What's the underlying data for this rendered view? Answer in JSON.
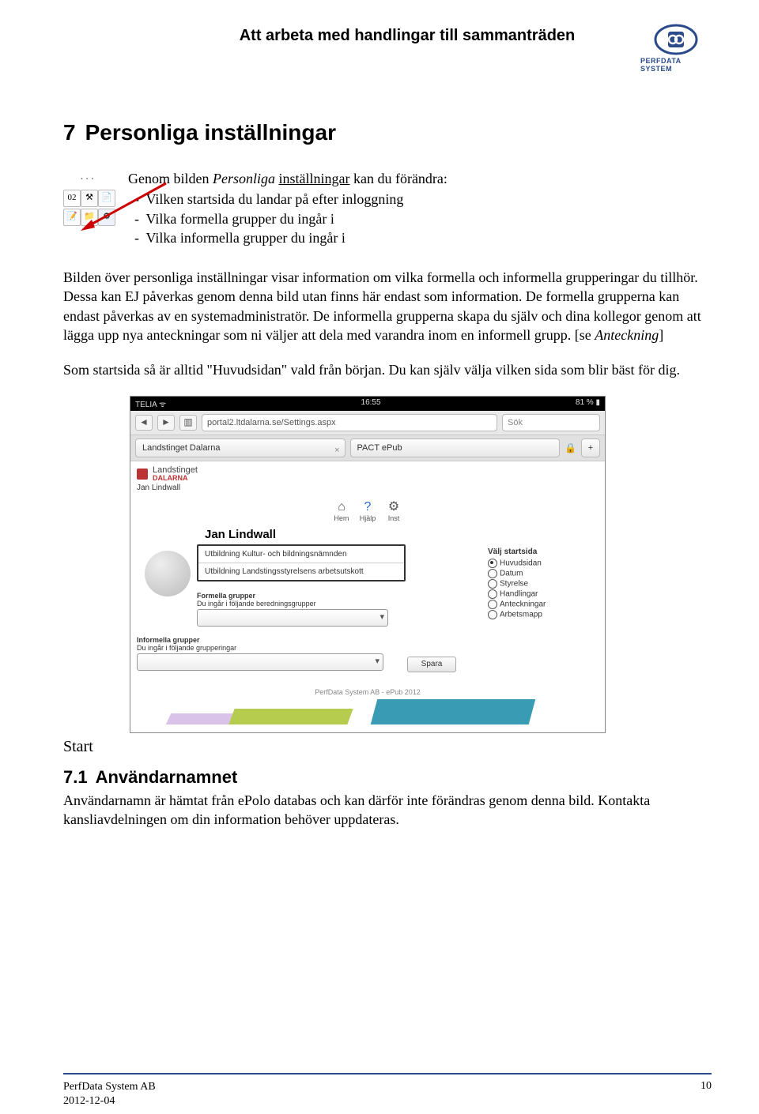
{
  "header": {
    "title": "Att arbeta med handlingar till sammanträden",
    "logo_text": "PERFDATA SYSTEM"
  },
  "section": {
    "number": "7",
    "title": "Personliga inställningar"
  },
  "intro": {
    "lead_prefix": "Genom bilden ",
    "lead_italic": "Personliga ",
    "lead_underline": "inställningar",
    "lead_suffix": " kan du förändra:",
    "bullets": [
      "Vilken startsida du landar på efter inloggning",
      "Vilka formella grupper du ingår i",
      "Vilka informella grupper du ingår i"
    ]
  },
  "para1_a": "Bilden över personliga inställningar visar information om vilka formella och informella grupperingar du tillhör. Dessa kan EJ påverkas genom denna bild utan finns här endast som information. De formella grupperna kan endast påverkas av en systemadministratör. De informella grupperna skapa du själv och dina kollegor genom att lägga upp nya anteckningar som ni väljer att dela med varandra inom en informell grupp. [se ",
  "para1_em": "Anteckning",
  "para1_b": "]",
  "para2": "Som startsida så är alltid \"Huvudsidan\" vald från början. Du kan själv välja vilken sida som blir bäst för dig.",
  "screenshot": {
    "status_left": "TELIA ᯤ",
    "status_time": "16:55",
    "status_right": "81 % ▮",
    "url": "portal2.ltdalarna.se/Settings.aspx",
    "search_placeholder": "Sök",
    "tab1": "Landstinget Dalarna",
    "tab2": "PACT ePub",
    "brand_top": "Landstinget",
    "brand_bottom": "DALARNA",
    "brand_user": "Jan Lindwall",
    "nav": {
      "hem": "Hem",
      "hjalp": "Hjälp",
      "inst": "Inst"
    },
    "profile_name": "Jan Lindwall",
    "formella_label": "Formella grupper",
    "formella_sub": "Du ingår i följande beredningsgrupper",
    "popup_options": [
      "Utbildning Kultur- och bildningsnämnden",
      "Utbildning Landstingsstyrelsens arbetsutskott"
    ],
    "startsida_label": "Välj startsida",
    "radios": [
      "Huvudsidan",
      "Datum",
      "Styrelse",
      "Handlingar",
      "Anteckningar",
      "Arbetsmapp"
    ],
    "informella_label": "Informella grupper",
    "informella_sub": "Du ingår i följande grupperingar",
    "save_label": "Spara",
    "footer_credit": "PerfData System AB - ePub 2012"
  },
  "start_label": "Start",
  "subsection": {
    "number": "7.1",
    "title": "Användarnamnet"
  },
  "para3": "Användarnamn är hämtat från ePolo databas och kan därför inte förändras genom denna bild. Kontakta kansliavdelningen om din information behöver uppdateras.",
  "footer": {
    "company": "PerfData System AB",
    "date": "2012-12-04",
    "page": "10"
  }
}
